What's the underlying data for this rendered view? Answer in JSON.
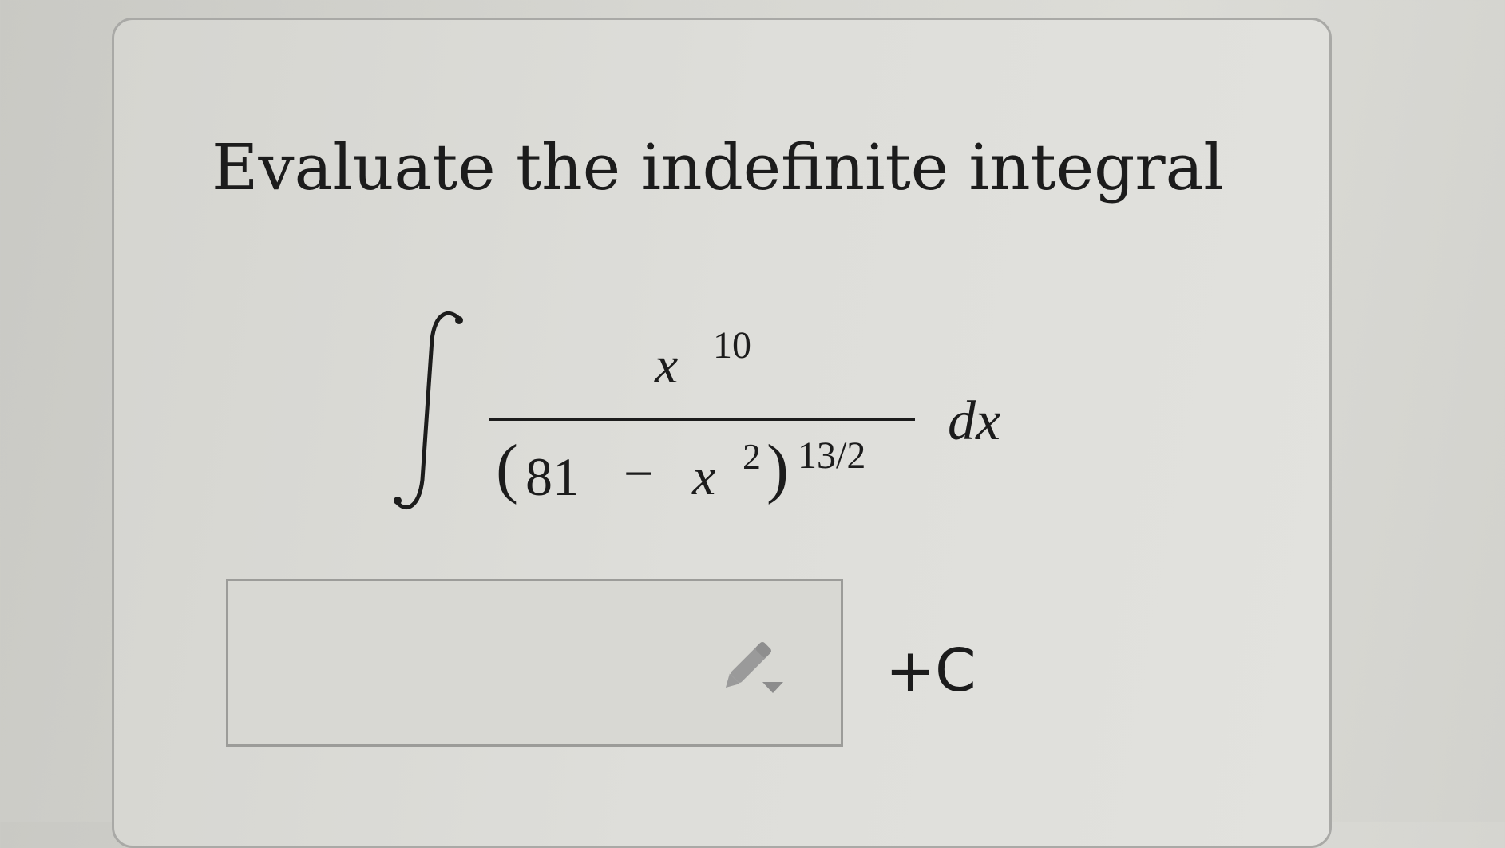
{
  "question": {
    "prompt": "Evaluate the indefinite integral"
  },
  "integral": {
    "integral_symbol": "∫",
    "numerator_base": "x",
    "numerator_exponent": "10",
    "denominator_open_paren": "(",
    "denominator_constant": "81",
    "denominator_operator": "−",
    "denominator_variable": "x",
    "denominator_variable_exponent": "2",
    "denominator_close_paren": ")",
    "denominator_exponent": "13/2",
    "differential": "dx"
  },
  "answer": {
    "input_value": "",
    "constant_suffix": "+C",
    "editor_icon": "pencil-dropdown-icon"
  },
  "colors": {
    "background": "#d6d6d1",
    "card_border": "#a9a9a6",
    "text": "#1c1c1c",
    "icon": "#9a9a9a"
  }
}
